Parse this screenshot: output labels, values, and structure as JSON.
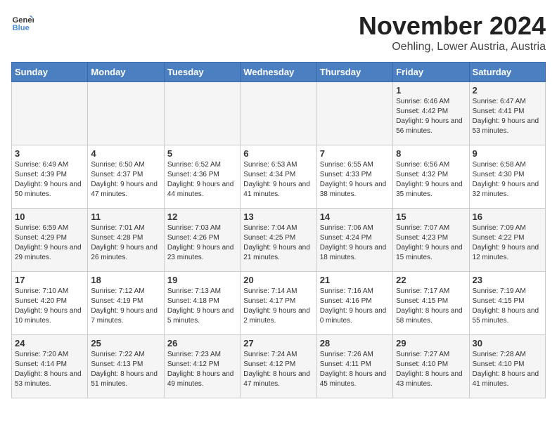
{
  "logo": {
    "text_general": "General",
    "text_blue": "Blue"
  },
  "title": "November 2024",
  "subtitle": "Oehling, Lower Austria, Austria",
  "headers": [
    "Sunday",
    "Monday",
    "Tuesday",
    "Wednesday",
    "Thursday",
    "Friday",
    "Saturday"
  ],
  "weeks": [
    [
      {
        "day": "",
        "info": ""
      },
      {
        "day": "",
        "info": ""
      },
      {
        "day": "",
        "info": ""
      },
      {
        "day": "",
        "info": ""
      },
      {
        "day": "",
        "info": ""
      },
      {
        "day": "1",
        "info": "Sunrise: 6:46 AM\nSunset: 4:42 PM\nDaylight: 9 hours and 56 minutes."
      },
      {
        "day": "2",
        "info": "Sunrise: 6:47 AM\nSunset: 4:41 PM\nDaylight: 9 hours and 53 minutes."
      }
    ],
    [
      {
        "day": "3",
        "info": "Sunrise: 6:49 AM\nSunset: 4:39 PM\nDaylight: 9 hours and 50 minutes."
      },
      {
        "day": "4",
        "info": "Sunrise: 6:50 AM\nSunset: 4:37 PM\nDaylight: 9 hours and 47 minutes."
      },
      {
        "day": "5",
        "info": "Sunrise: 6:52 AM\nSunset: 4:36 PM\nDaylight: 9 hours and 44 minutes."
      },
      {
        "day": "6",
        "info": "Sunrise: 6:53 AM\nSunset: 4:34 PM\nDaylight: 9 hours and 41 minutes."
      },
      {
        "day": "7",
        "info": "Sunrise: 6:55 AM\nSunset: 4:33 PM\nDaylight: 9 hours and 38 minutes."
      },
      {
        "day": "8",
        "info": "Sunrise: 6:56 AM\nSunset: 4:32 PM\nDaylight: 9 hours and 35 minutes."
      },
      {
        "day": "9",
        "info": "Sunrise: 6:58 AM\nSunset: 4:30 PM\nDaylight: 9 hours and 32 minutes."
      }
    ],
    [
      {
        "day": "10",
        "info": "Sunrise: 6:59 AM\nSunset: 4:29 PM\nDaylight: 9 hours and 29 minutes."
      },
      {
        "day": "11",
        "info": "Sunrise: 7:01 AM\nSunset: 4:28 PM\nDaylight: 9 hours and 26 minutes."
      },
      {
        "day": "12",
        "info": "Sunrise: 7:03 AM\nSunset: 4:26 PM\nDaylight: 9 hours and 23 minutes."
      },
      {
        "day": "13",
        "info": "Sunrise: 7:04 AM\nSunset: 4:25 PM\nDaylight: 9 hours and 21 minutes."
      },
      {
        "day": "14",
        "info": "Sunrise: 7:06 AM\nSunset: 4:24 PM\nDaylight: 9 hours and 18 minutes."
      },
      {
        "day": "15",
        "info": "Sunrise: 7:07 AM\nSunset: 4:23 PM\nDaylight: 9 hours and 15 minutes."
      },
      {
        "day": "16",
        "info": "Sunrise: 7:09 AM\nSunset: 4:22 PM\nDaylight: 9 hours and 12 minutes."
      }
    ],
    [
      {
        "day": "17",
        "info": "Sunrise: 7:10 AM\nSunset: 4:20 PM\nDaylight: 9 hours and 10 minutes."
      },
      {
        "day": "18",
        "info": "Sunrise: 7:12 AM\nSunset: 4:19 PM\nDaylight: 9 hours and 7 minutes."
      },
      {
        "day": "19",
        "info": "Sunrise: 7:13 AM\nSunset: 4:18 PM\nDaylight: 9 hours and 5 minutes."
      },
      {
        "day": "20",
        "info": "Sunrise: 7:14 AM\nSunset: 4:17 PM\nDaylight: 9 hours and 2 minutes."
      },
      {
        "day": "21",
        "info": "Sunrise: 7:16 AM\nSunset: 4:16 PM\nDaylight: 9 hours and 0 minutes."
      },
      {
        "day": "22",
        "info": "Sunrise: 7:17 AM\nSunset: 4:15 PM\nDaylight: 8 hours and 58 minutes."
      },
      {
        "day": "23",
        "info": "Sunrise: 7:19 AM\nSunset: 4:15 PM\nDaylight: 8 hours and 55 minutes."
      }
    ],
    [
      {
        "day": "24",
        "info": "Sunrise: 7:20 AM\nSunset: 4:14 PM\nDaylight: 8 hours and 53 minutes."
      },
      {
        "day": "25",
        "info": "Sunrise: 7:22 AM\nSunset: 4:13 PM\nDaylight: 8 hours and 51 minutes."
      },
      {
        "day": "26",
        "info": "Sunrise: 7:23 AM\nSunset: 4:12 PM\nDaylight: 8 hours and 49 minutes."
      },
      {
        "day": "27",
        "info": "Sunrise: 7:24 AM\nSunset: 4:12 PM\nDaylight: 8 hours and 47 minutes."
      },
      {
        "day": "28",
        "info": "Sunrise: 7:26 AM\nSunset: 4:11 PM\nDaylight: 8 hours and 45 minutes."
      },
      {
        "day": "29",
        "info": "Sunrise: 7:27 AM\nSunset: 4:10 PM\nDaylight: 8 hours and 43 minutes."
      },
      {
        "day": "30",
        "info": "Sunrise: 7:28 AM\nSunset: 4:10 PM\nDaylight: 8 hours and 41 minutes."
      }
    ]
  ]
}
